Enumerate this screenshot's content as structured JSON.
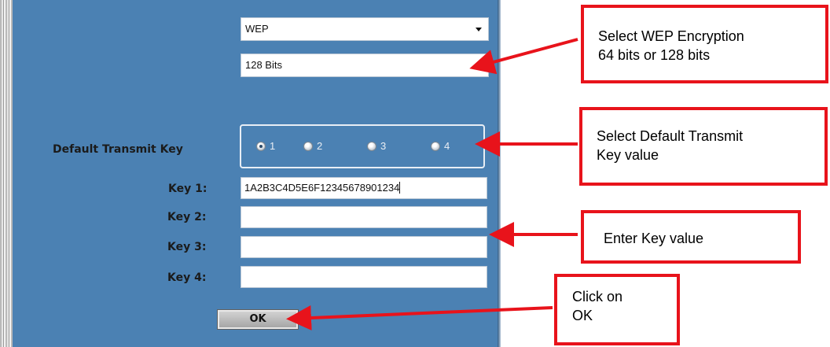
{
  "dialog": {
    "encryption_select": {
      "value": "WEP"
    },
    "bits_select": {
      "value": "128 Bits"
    },
    "default_key": {
      "label": "Default Transmit Key",
      "options": [
        "1",
        "2",
        "3",
        "4"
      ],
      "selected": "1"
    },
    "keys": [
      {
        "label": "Key 1:",
        "value": "1A2B3C4D5E6F12345678901234"
      },
      {
        "label": "Key 2:",
        "value": ""
      },
      {
        "label": "Key 3:",
        "value": ""
      },
      {
        "label": "Key 4:",
        "value": ""
      }
    ],
    "ok_label": "OK"
  },
  "callouts": {
    "encryption": [
      "Select WEP Encryption",
      "64 bits or 128 bits"
    ],
    "transmit_key": [
      "Select Default Transmit",
      "Key value"
    ],
    "key_value": [
      "Enter Key value"
    ],
    "ok": [
      "Click on",
      "OK"
    ]
  },
  "colors": {
    "panel": "#4b81b3",
    "callout_border": "#e8131b",
    "arrow": "#e8131b"
  }
}
